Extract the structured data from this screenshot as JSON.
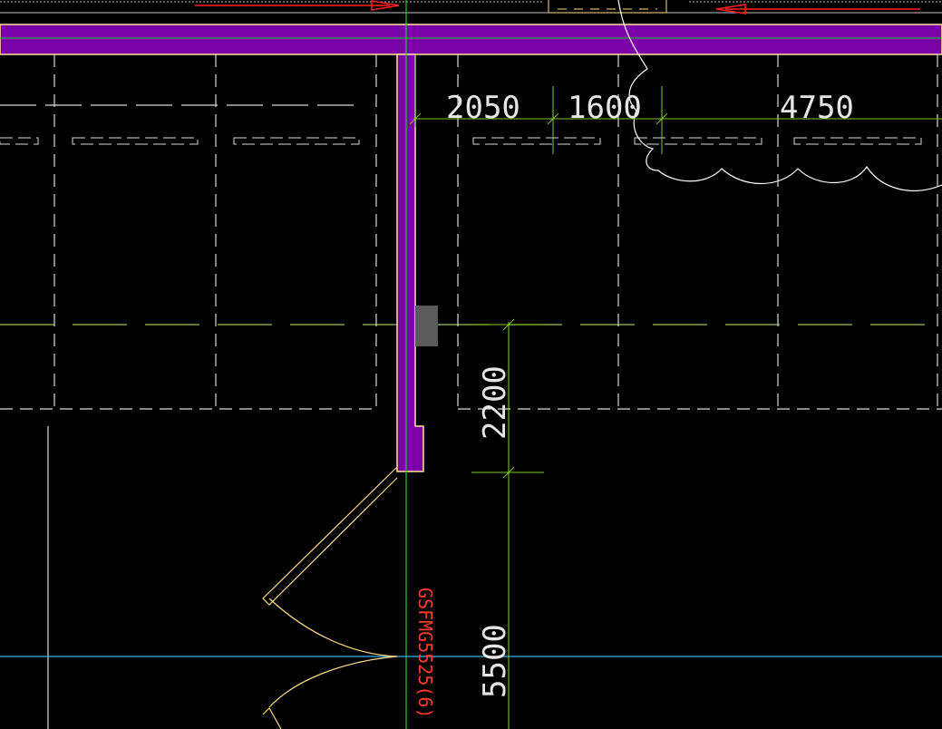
{
  "drawing": {
    "background": "#000000",
    "colors": {
      "wall_fill": "#7b00a8",
      "wall_outline": "#ffe29a",
      "grid_dash": "#d9d9d9",
      "dimension": "#7fcc2a",
      "door": "#ffd98a",
      "door_tag": "#ff3b2a",
      "cyan_axis": "#33b8e6",
      "green_axis": "#22cc33",
      "cloud": "#ffffff",
      "arrow": "#ff2020",
      "selection": "#5a5a5a"
    },
    "dimensions": {
      "d_2050": "2050",
      "d_1600": "1600",
      "d_4750": "4750",
      "d_2200": "2200",
      "d_5500": "5500"
    },
    "door_tag": "GSFMG5525(6)"
  }
}
